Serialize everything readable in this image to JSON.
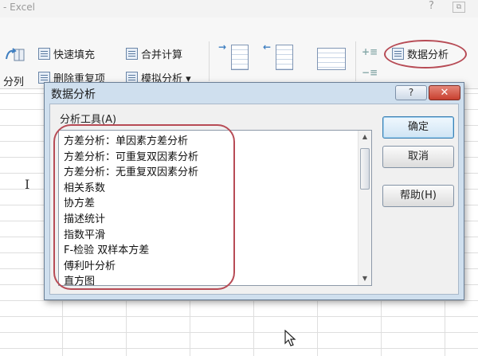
{
  "window": {
    "title": "- Excel",
    "help_glyph": "?",
    "restore_glyph": "⧉"
  },
  "ribbon": {
    "flash_fill": "快速填充",
    "remove_duplicates": "删除重复项",
    "consolidate": "合并计算",
    "what_if": "模拟分析 ▾",
    "text_to_columns": "分列",
    "data_analysis": "数据分析"
  },
  "dialog": {
    "title": "数据分析",
    "help_glyph": "?",
    "close_glyph": "✕",
    "tools_label": "分析工具(A)",
    "items": [
      "方差分析：单因素方差分析",
      "方差分析：可重复双因素分析",
      "方差分析：无重复双因素分析",
      "相关系数",
      "协方差",
      "描述统计",
      "指数平滑",
      "F-检验 双样本方差",
      "傅利叶分析",
      "直方图"
    ],
    "ok_label": "确定",
    "cancel_label": "取消",
    "help_label": "帮助(H)"
  },
  "colors": {
    "annotation_circle": "#b74b55",
    "dialog_frame": "#cfdfee",
    "close_button": "#c8402f"
  }
}
